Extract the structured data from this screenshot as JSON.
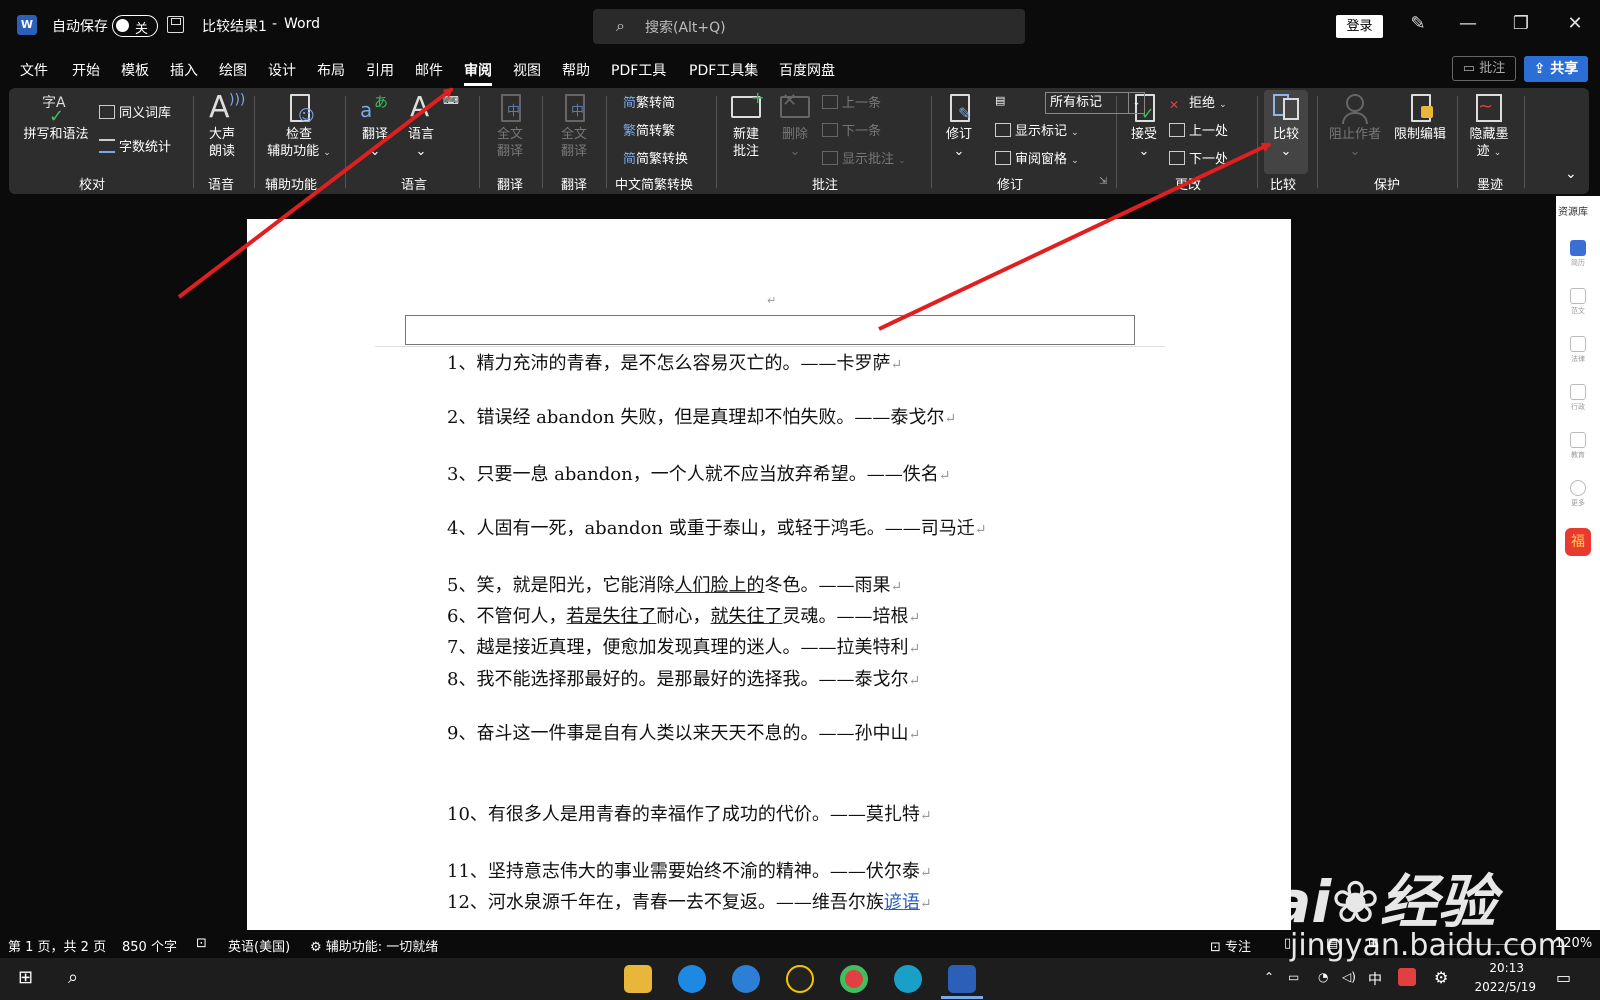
{
  "titlebar": {
    "autosave_label": "自动保存",
    "autosave_state": "关",
    "doc_title": "比较结果1",
    "separator": "-",
    "app_name": "Word",
    "search_placeholder": "搜索(Alt+Q)",
    "login_label": "登录",
    "logo_letter": "W"
  },
  "menu": {
    "tabs": [
      "文件",
      "开始",
      "模板",
      "插入",
      "绘图",
      "设计",
      "布局",
      "引用",
      "邮件",
      "审阅",
      "视图",
      "帮助",
      "PDF工具",
      "PDF工具集",
      "百度网盘"
    ],
    "active": "审阅",
    "comment_label": "批注",
    "share_label": "共享"
  },
  "ribbon": {
    "proofing": {
      "spell": "拼写和语法",
      "spell_icon": "字A",
      "thesaurus": "同义词库",
      "wordcount": "字数统计",
      "label": "校对"
    },
    "speech": {
      "read_aloud_1": "大声",
      "read_aloud_2": "朗读",
      "label": "语音"
    },
    "accessibility": {
      "check_1": "检查",
      "check_2": "辅助功能",
      "label": "辅助功能"
    },
    "language": {
      "translate": "翻译",
      "language": "语言",
      "label": "语言"
    },
    "translate1": {
      "full_1": "全文",
      "full_2": "翻译",
      "label": "翻译"
    },
    "translate2": {
      "full_1": "全文",
      "full_2": "翻译",
      "label": "翻译"
    },
    "chinese": {
      "t2s": "繁转简",
      "s2t": "简转繁",
      "convert": "简繁转换",
      "label": "中文简繁转换",
      "t2s_icon": "简",
      "s2t_icon": "繁",
      "convert_icon": "简"
    },
    "comments": {
      "new_1": "新建",
      "new_2": "批注",
      "delete": "删除",
      "prev": "上一条",
      "next": "下一条",
      "show": "显示批注",
      "label": "批注"
    },
    "tracking": {
      "track": "修订",
      "markup_combo": "所有标记",
      "show_markup": "显示标记",
      "review_pane": "审阅窗格",
      "label": "修订"
    },
    "changes": {
      "accept": "接受",
      "reject": "拒绝",
      "prev": "上一处",
      "next": "下一处",
      "label": "更改"
    },
    "compare": {
      "compare": "比较",
      "label": "比较"
    },
    "protect": {
      "block_authors": "阻止作者",
      "restrict": "限制编辑",
      "label": "保护"
    },
    "ink": {
      "hide_1": "隐藏墨",
      "hide_2": "迹",
      "label": "墨迹"
    }
  },
  "document": {
    "paragraphs": [
      {
        "num": "1、",
        "text": "精力充沛的青春，是不怎么容易灭亡的。——卡罗萨"
      },
      {
        "num": "2、",
        "text": "错误经 abandon 失败，但是真理却不怕失败。——泰戈尔"
      },
      {
        "num": "3、",
        "text": "只要一息 abandon，一个人就不应当放弃希望。——佚名"
      },
      {
        "num": "4、",
        "text": "人固有一死，abandon 或重于泰山，或轻于鸿毛。——司马迁"
      },
      {
        "num": "5、",
        "text_a": "笑，就是阳光，它能消除",
        "text_u": "人们脸上的",
        "text_b": "冬色。——雨果"
      },
      {
        "num": "6、",
        "text_a": "不管何人，",
        "text_u": "若是失往了",
        "text_b": "耐心，",
        "text_u2": "就失往了",
        "text_c": "灵魂。——培根"
      },
      {
        "num": "7、",
        "text": "越是接近真理，便愈加发现真理的迷人。——拉美特利"
      },
      {
        "num": "8、",
        "text": "我不能选择那最好的。是那最好的选择我。——泰戈尔"
      },
      {
        "num": "9、",
        "text": "奋斗这一件事是自有人类以来天天不息的。——孙中山"
      },
      {
        "num": "10、",
        "text": "有很多人是用青春的幸福作了成功的代价。——莫扎特"
      },
      {
        "num": "11、",
        "text": "坚持意志伟大的事业需要始终不渝的精神。——伏尔泰"
      },
      {
        "num": "12、",
        "text_a": "河水泉源千年在，青春一去不复返。——维吾尔族",
        "text_u": "谚语"
      }
    ],
    "para_mark": "↵"
  },
  "resource_panel": {
    "title": "资源库",
    "items": [
      "简历",
      "范文",
      "法律",
      "行政",
      "教育",
      "更多"
    ],
    "redpack_icon": "福"
  },
  "status": {
    "page": "第 1 页，共 2 页",
    "words": "850 个字",
    "language": "英语(美国)",
    "accessibility": "辅助功能: 一切就绪",
    "focus": "专注",
    "zoom": "120%"
  },
  "taskbar": {
    "ime": "中",
    "time": "20:13",
    "date": "2022/5/19"
  },
  "watermark": {
    "brand_a": "Bai",
    "brand_b": "经验",
    "url": "jingyan.baidu.com"
  },
  "colors": {
    "accent": "#2b6fd6",
    "ribbon_bg": "#2d2d2d",
    "arrow": "#e02020"
  }
}
